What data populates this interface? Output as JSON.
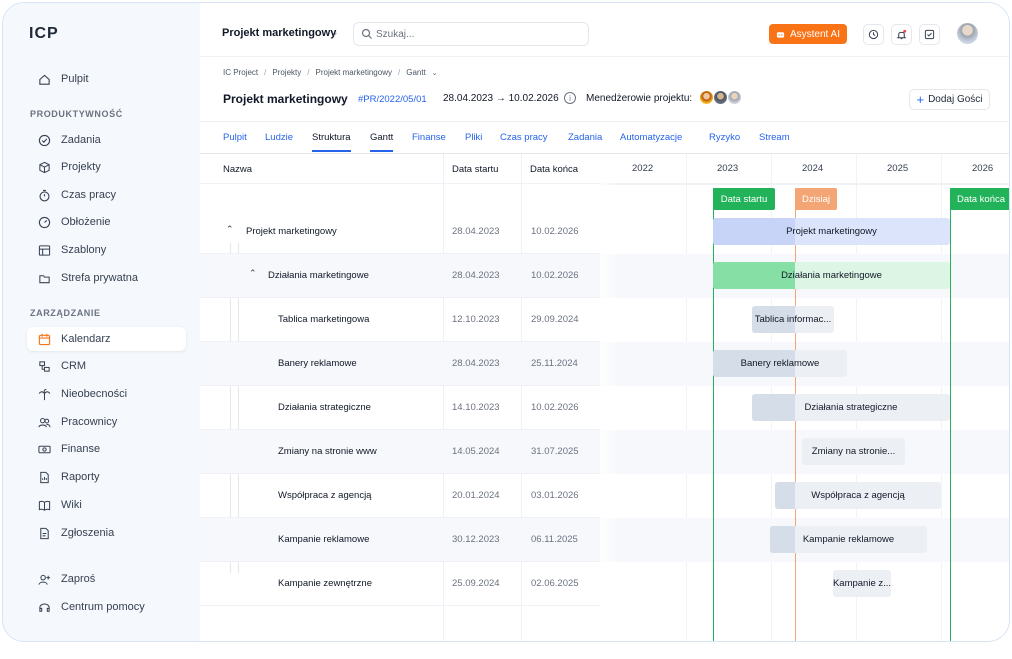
{
  "app": {
    "logo": "ICP"
  },
  "sidebar": {
    "top_item": {
      "label": "Pulpit",
      "icon": "home-icon"
    },
    "section_products": "PRODUKTYWNOŚĆ",
    "products": [
      {
        "label": "Zadania",
        "icon": "check-circle-icon"
      },
      {
        "label": "Projekty",
        "icon": "cube-icon"
      },
      {
        "label": "Czas pracy",
        "icon": "stopwatch-icon"
      },
      {
        "label": "Obłożenie",
        "icon": "gauge-icon"
      },
      {
        "label": "Szablony",
        "icon": "template-icon"
      },
      {
        "label": "Strefa prywatna",
        "icon": "folder-icon"
      }
    ],
    "section_management": "ZARZĄDZANIE",
    "management": [
      {
        "label": "Kalendarz",
        "icon": "calendar-icon",
        "active": true
      },
      {
        "label": "CRM",
        "icon": "crm-icon"
      },
      {
        "label": "Nieobecności",
        "icon": "palm-icon"
      },
      {
        "label": "Pracownicy",
        "icon": "users-icon"
      },
      {
        "label": "Finanse",
        "icon": "money-icon"
      },
      {
        "label": "Raporty",
        "icon": "report-icon"
      },
      {
        "label": "Wiki",
        "icon": "book-icon"
      },
      {
        "label": "Zgłoszenia",
        "icon": "ticket-icon"
      }
    ],
    "bottom": [
      {
        "label": "Zaproś",
        "icon": "add-user-icon"
      },
      {
        "label": "Centrum pomocy",
        "icon": "headset-icon"
      }
    ]
  },
  "topbar": {
    "project_select": "Projekt marketingowy",
    "search_placeholder": "Szukaj...",
    "ai_button": "Asystent AI",
    "accent": "#f97316"
  },
  "breadcrumb": [
    "IC Project",
    "Projekty",
    "Projekt marketingowy",
    "Gantt"
  ],
  "header": {
    "title": "Projekt marketingowy",
    "code": "#PR/2022/05/01",
    "dates": "28.04.2023 → 10.02.2026",
    "managers_label": "Menedżerowie projektu:",
    "guest_button": "Dodaj Gości"
  },
  "tabs": [
    "Pulpit",
    "Ludzie",
    "Struktura",
    "Gantt",
    "Finanse",
    "Pliki",
    "Czas pracy",
    "Zadania",
    "Automatyzacje",
    "Ryzyko",
    "Stream"
  ],
  "active_tabs": [
    "Struktura",
    "Gantt"
  ],
  "table": {
    "columns": [
      "Nazwa",
      "Data startu",
      "Data końca"
    ],
    "rows": [
      {
        "name": "Projekt marketingowy",
        "start": "28.04.2023",
        "end": "10.02.2026",
        "level": 0,
        "expanded": true
      },
      {
        "name": "Działania marketingowe",
        "start": "28.04.2023",
        "end": "10.02.2026",
        "level": 1,
        "expanded": true
      },
      {
        "name": "Tablica marketingowa",
        "start": "12.10.2023",
        "end": "29.09.2024",
        "level": 2
      },
      {
        "name": "Banery reklamowe",
        "start": "28.04.2023",
        "end": "25.11.2024",
        "level": 2
      },
      {
        "name": "Działania strategiczne",
        "start": "14.10.2023",
        "end": "10.02.2026",
        "level": 2
      },
      {
        "name": "Zmiany na stronie www",
        "start": "14.05.2024",
        "end": "31.07.2025",
        "level": 2
      },
      {
        "name": "Współpraca z agencją",
        "start": "20.01.2024",
        "end": "03.01.2026",
        "level": 2
      },
      {
        "name": "Kampanie reklamowe",
        "start": "30.12.2023",
        "end": "06.11.2025",
        "level": 2
      },
      {
        "name": "Kampanie zewnętrzne",
        "start": "25.09.2024",
        "end": "02.06.2025",
        "level": 2
      }
    ]
  },
  "gantt": {
    "years": [
      "2022",
      "2023",
      "2024",
      "2025",
      "2026"
    ],
    "markers": {
      "start": "Data startu",
      "today": "Dzisiaj",
      "end": "Data końca"
    },
    "bar_labels": [
      "Projekt marketingowy",
      "Działania marketingowe",
      "Tablica informac...",
      "Banery reklamowe",
      "Działania strategiczne",
      "Zmiany na stronie...",
      "Współpraca z agencją",
      "Kampanie reklamowe",
      "Kampanie z..."
    ],
    "colors": {
      "project": "#dbe4fb",
      "project_done": "#c7d4f7",
      "group": "#dcf5e4",
      "group_done": "#86e0a6",
      "task": "#eceff4",
      "task_done": "#d5dde8",
      "start": "#22b35a",
      "today": "#f4a576",
      "end": "#22b35a"
    }
  }
}
